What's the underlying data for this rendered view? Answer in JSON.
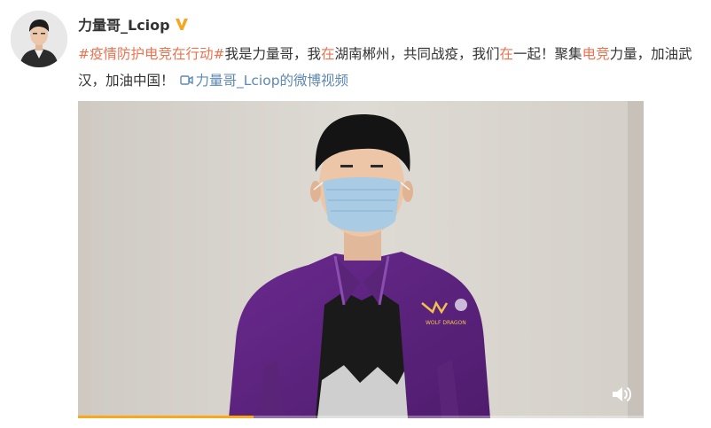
{
  "post": {
    "author": {
      "name": "力量哥_Lciop",
      "verified_icon": "verified-v-icon",
      "verified_color": "#f5a623"
    },
    "text": {
      "topic": "#疫情防护电竞在行动#",
      "seg1": "我是力量哥，我",
      "hl1": "在",
      "seg2": "湖南郴州，共同战疫，我们",
      "hl2": "在",
      "seg3": "一起！聚集",
      "hl3": "电竞",
      "seg4": "力量，加油武汉，加油中国！",
      "video_link_icon": "video-camera-icon",
      "video_link": "力量哥_Lciop的微博视频"
    },
    "video": {
      "progress": 0.31,
      "volume_icon": "speaker-icon",
      "jacket_logo_text": "WOLF DRAGON"
    },
    "colors": {
      "link": "#5d88b5",
      "topic": "#eb7350",
      "progress": "#f7a91a"
    }
  }
}
